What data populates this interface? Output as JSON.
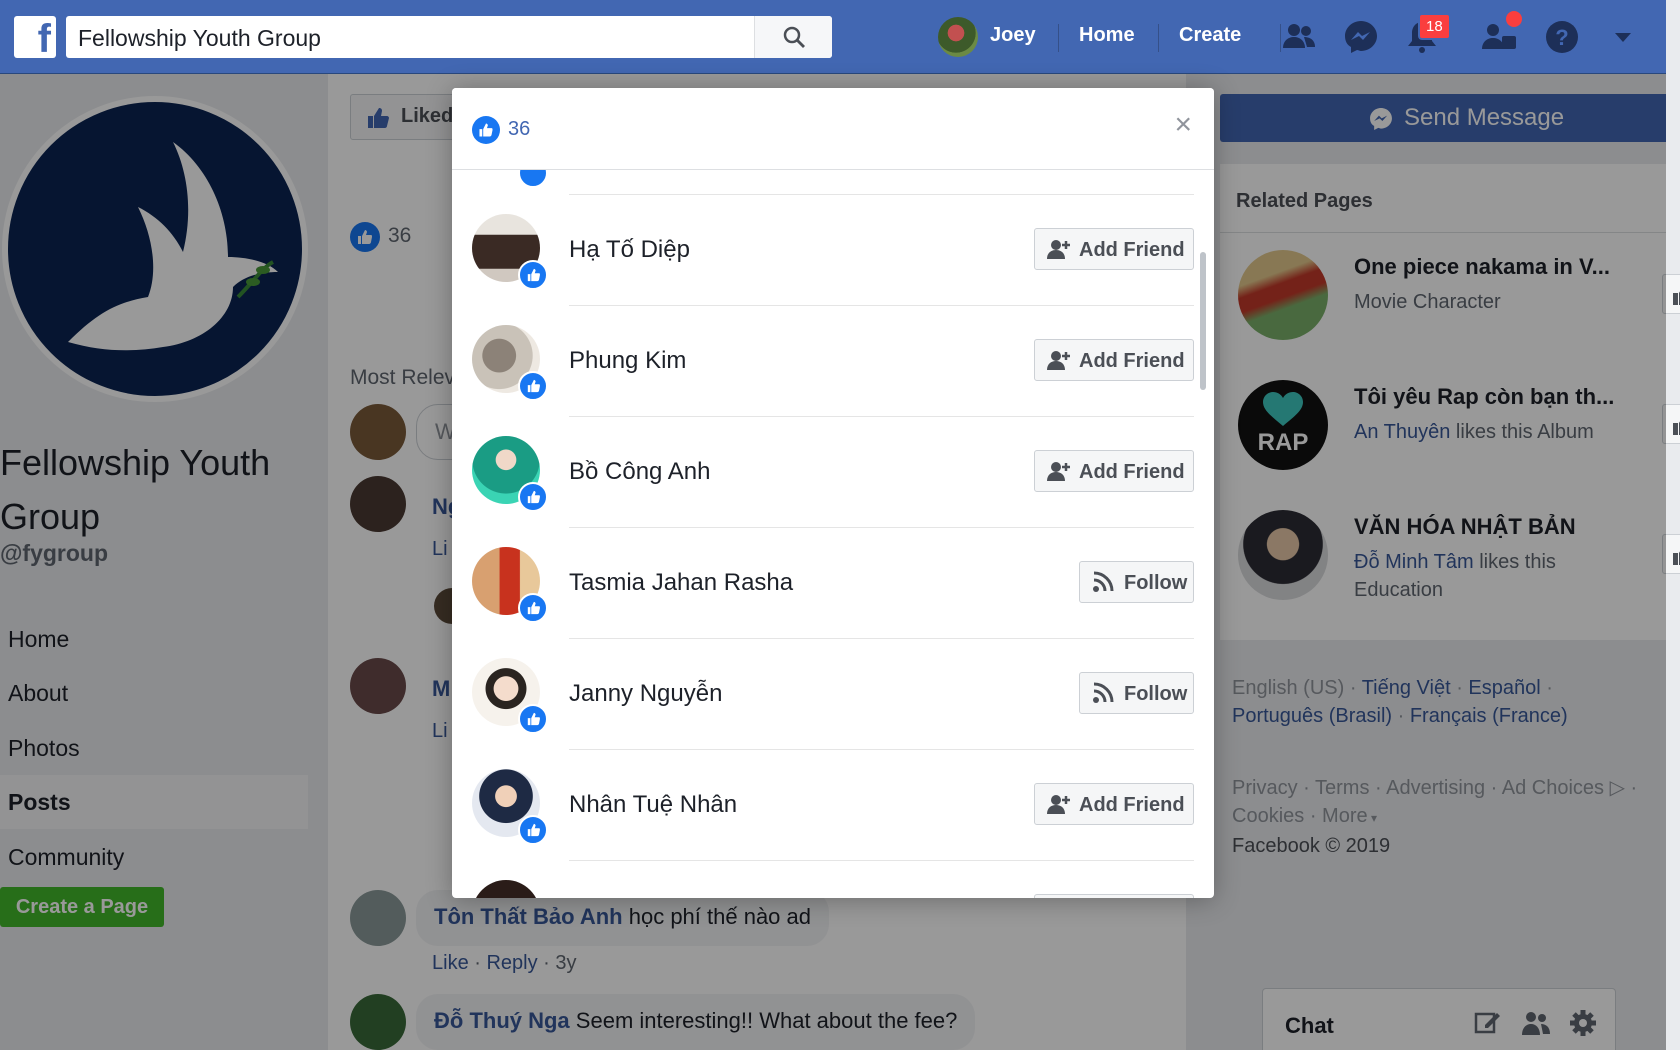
{
  "topbar": {
    "logo_letter": "f",
    "search_value": "Fellowship Youth Group",
    "user_name": "Joey",
    "home_label": "Home",
    "create_label": "Create",
    "notification_count": "18"
  },
  "page": {
    "name": "Fellowship Youth Group",
    "handle": "@fygroup",
    "nav": [
      "Home",
      "About",
      "Photos",
      "Posts",
      "Community"
    ],
    "active_nav": "Posts",
    "create_page_label": "Create a Page"
  },
  "center": {
    "liked_label": "Liked",
    "like_count": "36",
    "most_relevant": "Most Relev",
    "comment_placeholder_initial": "W",
    "partial_names": [
      "Ng",
      "M"
    ],
    "partial_links": [
      "Li",
      "Li"
    ],
    "comments": [
      {
        "name": "Tôn Thất Bảo Anh",
        "text": "học phí thế nào ad",
        "like": "Like",
        "reply": "Reply",
        "age": "3y"
      },
      {
        "name": "Đỗ Thuý Nga",
        "text": "Seem interesting!! What about the fee?"
      }
    ]
  },
  "right": {
    "send_message_label": "Send Message",
    "related_title": "Related Pages",
    "related": [
      {
        "name": "One piece nakama in V...",
        "friend": "",
        "sub": "Movie Character",
        "color": "#c9a44a"
      },
      {
        "name": "Tôi yêu Rap còn bạn th...",
        "friend": "An Thuyên",
        "sub": " likes this Album",
        "color": "#111111"
      },
      {
        "name": "VĂN HÓA NHẬT BẢN",
        "friend": "Đỗ Minh Tâm",
        "sub": " likes this Education",
        "color": "#8a8f98"
      }
    ],
    "like_btn_partial": "L",
    "languages": [
      "English (US)",
      "Tiếng Việt",
      "Español",
      "Português (Brasil)",
      "Français (France)"
    ],
    "footer_links": [
      "Privacy",
      "Terms",
      "Advertising",
      "Ad Choices",
      "Cookies",
      "More"
    ],
    "copyright": "Facebook © 2019",
    "chat_label": "Chat"
  },
  "modal": {
    "like_count": "36",
    "close_symbol": "×",
    "people": [
      {
        "name": "Hạ Tố Diệp",
        "action": "Add Friend",
        "avatar_color": "#d7d2cc"
      },
      {
        "name": "Phung Kim",
        "action": "Add Friend",
        "avatar_color": "#a8a29a"
      },
      {
        "name": "Bồ Công Anh",
        "action": "Add Friend",
        "avatar_color": "#22b8a0"
      },
      {
        "name": "Tasmia Jahan Rasha",
        "action": "Follow",
        "avatar_color": "#c8462a"
      },
      {
        "name": "Janny Nguyễn",
        "action": "Follow",
        "avatar_color": "#ece8e2"
      },
      {
        "name": "Nhân Tuệ Nhân",
        "action": "Add Friend",
        "avatar_color": "#2c4a7a"
      }
    ]
  },
  "colors": {
    "brand": "#4267b2",
    "like_blue": "#1877f2",
    "link": "#385898",
    "green": "#42b72a",
    "badge_red": "#fa3e3e"
  }
}
